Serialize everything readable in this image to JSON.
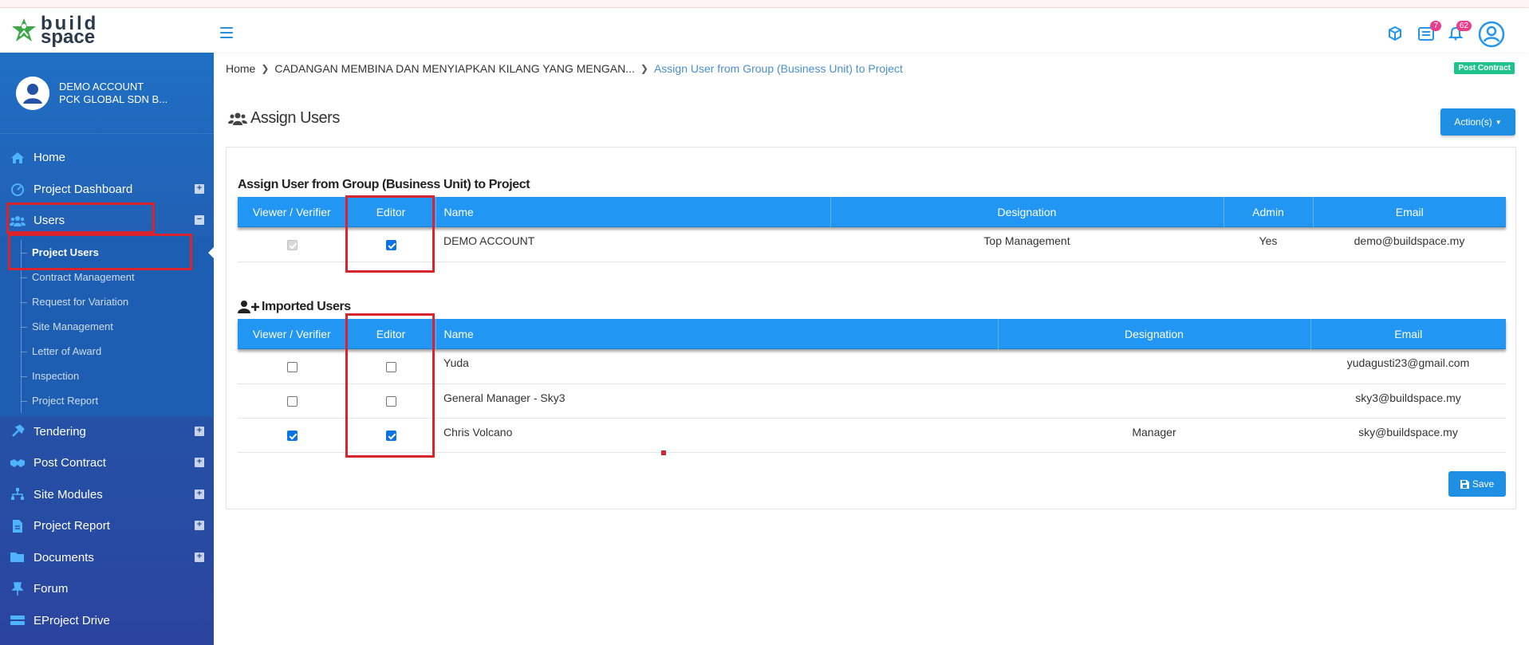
{
  "app": {
    "logo_line1": "build",
    "logo_line2": "space",
    "tm": "™"
  },
  "topbar": {
    "notifications_badge": "7",
    "alerts_badge": "62"
  },
  "profile": {
    "name": "DEMO ACCOUNT",
    "company": "PCK GLOBAL SDN B..."
  },
  "sidebar": {
    "items": [
      {
        "label": "Home",
        "icon": "home-icon"
      },
      {
        "label": "Project Dashboard",
        "icon": "dashboard-icon",
        "expand": "+"
      },
      {
        "label": "Users",
        "icon": "users-icon",
        "expand": "−"
      }
    ],
    "users_sub": [
      {
        "label": "Project Users"
      },
      {
        "label": "Contract Management"
      },
      {
        "label": "Request for Variation"
      },
      {
        "label": "Site Management"
      },
      {
        "label": "Letter of Award"
      },
      {
        "label": "Inspection"
      },
      {
        "label": "Project Report"
      }
    ],
    "items_after": [
      {
        "label": "Tendering",
        "icon": "hammer-icon",
        "expand": "+"
      },
      {
        "label": "Post Contract",
        "icon": "handshake-icon",
        "expand": "+"
      },
      {
        "label": "Site Modules",
        "icon": "sitemap-icon",
        "expand": "+"
      },
      {
        "label": "Project Report",
        "icon": "file-icon",
        "expand": "+"
      },
      {
        "label": "Documents",
        "icon": "folder-icon",
        "expand": "+"
      },
      {
        "label": "Forum",
        "icon": "pin-icon"
      },
      {
        "label": "EProject Drive",
        "icon": "drive-icon"
      }
    ]
  },
  "breadcrumb": {
    "home": "Home",
    "project": "CADANGAN MEMBINA DAN MENYIAPKAN KILANG YANG MENGAN...",
    "current": "Assign User from Group (Business Unit) to Project"
  },
  "badge_post_contract": "Post Contract",
  "page": {
    "title": "Assign Users",
    "actions_label": "Action(s)"
  },
  "group_section": {
    "title": "Assign User from Group (Business Unit) to Project",
    "headers": [
      "Viewer / Verifier",
      "Editor",
      "Name",
      "Designation",
      "Admin",
      "Email"
    ],
    "rows": [
      {
        "viewer": "checked-disabled",
        "editor": "checked",
        "name": "DEMO ACCOUNT",
        "designation": "Top Management",
        "admin": "Yes",
        "email": "demo@buildspace.my"
      }
    ]
  },
  "imported_section": {
    "title": "Imported Users",
    "headers": [
      "Viewer / Verifier",
      "Editor",
      "Name",
      "Designation",
      "Email"
    ],
    "rows": [
      {
        "viewer": "unchecked",
        "editor": "unchecked",
        "name": "Yuda",
        "designation": "",
        "email": "yudagusti23@gmail.com"
      },
      {
        "viewer": "unchecked",
        "editor": "unchecked",
        "name": "General Manager - Sky3",
        "designation": "",
        "email": "sky3@buildspace.my"
      },
      {
        "viewer": "checked",
        "editor": "checked",
        "name": "Chris Volcano",
        "designation": "Manager",
        "email": "sky@buildspace.my"
      }
    ]
  },
  "save_label": "Save",
  "colors": {
    "primary": "#2196f3",
    "sidebar": "#2452a6",
    "highlight": "#d9232d",
    "badge_green": "#20c38c"
  }
}
